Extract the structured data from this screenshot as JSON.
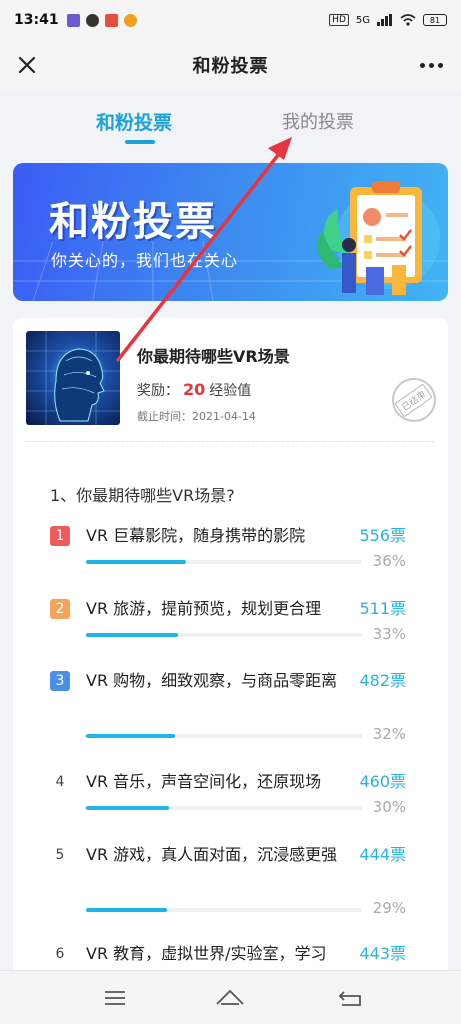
{
  "status_bar": {
    "time": "13:41",
    "network": "5G",
    "battery": "81"
  },
  "nav": {
    "title": "和粉投票"
  },
  "tabs": [
    {
      "label": "和粉投票",
      "active": true
    },
    {
      "label": "我的投票",
      "active": false
    }
  ],
  "banner": {
    "title": "和粉投票",
    "subtitle": "你关心的，我们也在关心"
  },
  "vote": {
    "title": "你最期待哪些VR场景",
    "reward_label": "奖励：",
    "reward_value": "20",
    "reward_unit": "经验值",
    "deadline": "截止时间：2021-04-14",
    "status_stamp": "已结束"
  },
  "question": "1、你最期待哪些VR场景?",
  "options": [
    {
      "rank": "1",
      "text": "VR 巨幕影院，随身携带的影院",
      "votes": "556票",
      "percent": "36%",
      "ratio": 0.36
    },
    {
      "rank": "2",
      "text": "VR 旅游，提前预览，规划更合理",
      "votes": "511票",
      "percent": "33%",
      "ratio": 0.33
    },
    {
      "rank": "3",
      "text": "VR 购物，细致观察，与商品零距离",
      "votes": "482票",
      "percent": "32%",
      "ratio": 0.32
    },
    {
      "rank": "4",
      "text": "VR 音乐，声音空间化，还原现场",
      "votes": "460票",
      "percent": "30%",
      "ratio": 0.3
    },
    {
      "rank": "5",
      "text": "VR 游戏，真人面对面，沉浸感更强",
      "votes": "444票",
      "percent": "29%",
      "ratio": 0.29
    },
    {
      "rank": "6",
      "text": "VR 教育，虚拟世界/实验室，学习",
      "votes": "443票",
      "percent": "",
      "ratio": 0.29
    }
  ],
  "colors": {
    "accent": "#1aa3d8",
    "rank1": "#ee5a5a",
    "rank2": "#f5a35a",
    "rank3": "#4a8fe6",
    "reward": "#e33333",
    "arrow": "#e8343c"
  },
  "icons": [
    "close-icon",
    "more-icon",
    "menu-icon",
    "home-icon",
    "back-icon"
  ]
}
